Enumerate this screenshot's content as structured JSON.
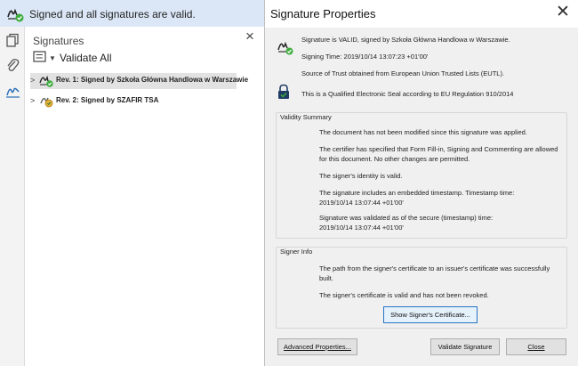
{
  "banner": {
    "text": "Signed and all signatures are valid."
  },
  "signatures_panel": {
    "title": "Signatures",
    "validate_all": "Validate All",
    "revisions": [
      {
        "label": "Rev. 1: Signed by Szkoła Główna Handlowa w Warszawie"
      },
      {
        "label": "Rev. 2: Signed by SZAFIR TSA"
      }
    ]
  },
  "dialog": {
    "title": "Signature Properties",
    "summary": {
      "status": "Signature is VALID, signed by Szkoła Główna Handlowa w Warszawie.",
      "signing_time": "Signing Time:  2019/10/14 13:07:23 +01'00'",
      "trust_source": "Source of Trust obtained from European Union Trusted Lists (EUTL).",
      "seal": "This is a Qualified Electronic Seal according to EU Regulation 910/2014"
    },
    "validity": {
      "label": "Validity Summary",
      "items": [
        "The document has not been modified since this signature was applied.",
        "The certifier has specified that Form Fill-in, Signing and Commenting are allowed",
        "for this document. No other changes are permitted.",
        "The signer's identity is valid.",
        "The signature includes an embedded timestamp. Timestamp time:",
        "2019/10/14 13:07:44 +01'00'",
        "Signature was validated as of the secure (timestamp) time:",
        "2019/10/14 13:07:44 +01'00'"
      ]
    },
    "signer_info": {
      "label": "Signer Info",
      "items": [
        "The path from the signer's certificate to an issuer's certificate was successfully",
        "built.",
        "The signer's certificate is valid and has not been revoked."
      ],
      "show_cert_button": "Show Signer's Certificate..."
    },
    "buttons": {
      "advanced": "Advanced Properties...",
      "validate": "Validate Signature",
      "close": "Close"
    }
  },
  "colors": {
    "banner_bg": "#dbe7f6",
    "dialog_bg": "#f0f0f0",
    "valid_green": "#3dac3d",
    "accent_blue": "#2a74c4"
  },
  "icons": {
    "banner": "signature-valid-icon",
    "rail": [
      "pages-icon",
      "attachment-icon",
      "signature-icon"
    ],
    "close": "close-icon"
  }
}
